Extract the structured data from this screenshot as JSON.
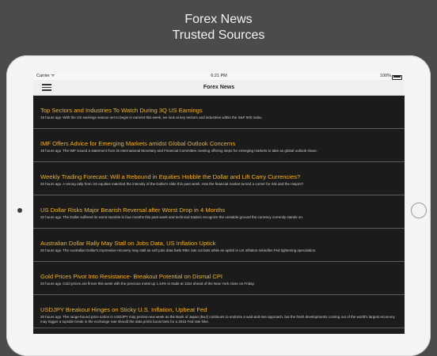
{
  "header": {
    "line1": "Forex News",
    "line2": "Trusted Sources"
  },
  "statusbar": {
    "carrier": "Carrier ᯤ",
    "time": "6:21 PM",
    "battery": "100%"
  },
  "navbar": {
    "title": "Forex News"
  },
  "news": [
    {
      "title": "Top Sectors and Industries To Watch During 3Q US Earnings",
      "age": "19 hours ago",
      "summary": "With the US earnings season set to begin in earnest this week, we look at key sectors and industries within the S&P 500 index."
    },
    {
      "title": "IMF Offers Advice for Emerging Markets amidst Global Outlook Concerns",
      "age": "19 hours ago",
      "summary": "The IMF issued a statement from its International Monetary and Financial Committee meeting offering steps for emerging markets to take as global outlook slows."
    },
    {
      "title": "Weekly Trading Forecast: Will a Rebound in Equities Hobble the Dollar and Lift Carry Currencies?",
      "age": "20 hours ago",
      "summary": "A strong rally from US equities matched the intensity of the Dollar's slide this past week. Has the financial market turned a corner for risk and the majors?"
    },
    {
      "title": "US Dollar Risks Major Bearish Reversal after Worst Drop in 4 Months",
      "age": "20 hours ago",
      "summary": "The Dollar suffered its worst stumble in four months this past week and technical traders recognize the unstable ground the currency currently stands on."
    },
    {
      "title": "Australian Dollar Rally May Stall on Jobs Data, US Inflation Uptick",
      "age": "20 hours ago",
      "summary": "The Australian Dollar's impressive recovery may stall as soft jobs data fuels RBA rate cut bets while an uptick in US inflation rekindles Fed tightening speculation."
    },
    {
      "title": "Gold Prices Pivot Into Resistance- Breakout Potential on Dismal CPI",
      "age": "20 hours ago",
      "summary": "Gold prices are firmer this week with the precious metal up 1.44% to trade at 1154 ahead of the New York close on Friday."
    },
    {
      "title": "USDJPY Breakout Hinges on Sticky U.S. Inflation, Upbeat Fed",
      "age": "20 hours ago",
      "summary": "The range-bound price action in USDJPY may persist next week as the Bank of Japan (BoJ) continues to endorse a wait-and-see approach, but the fresh developments coming out of the world's largest economy may trigger a topside break in the exchange rate should the data prints boost bets for a 2015 Fed rate hike."
    }
  ]
}
